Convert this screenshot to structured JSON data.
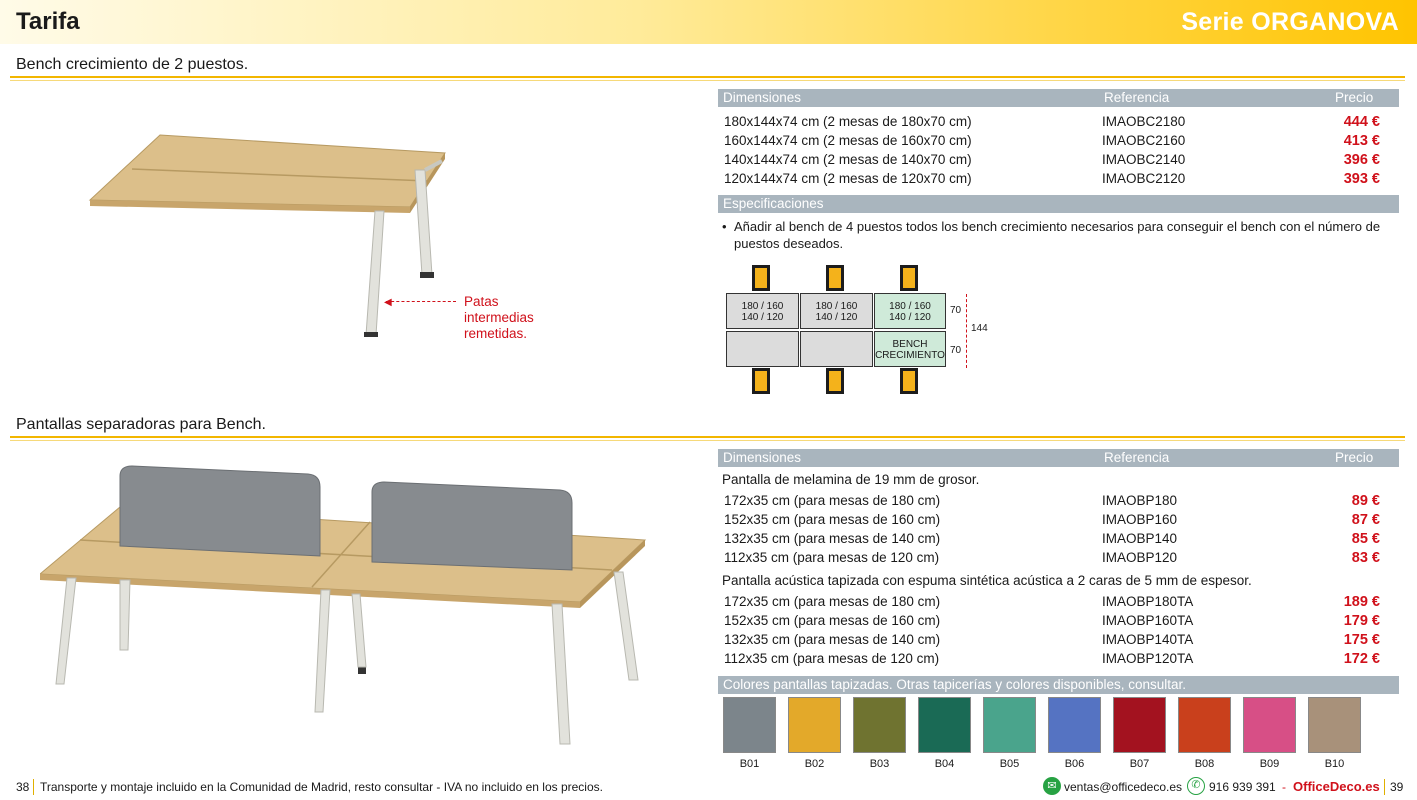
{
  "header": {
    "left_title": "Tarifa",
    "right_title": "Serie ORGANOVA"
  },
  "bench": {
    "title": "Bench crecimiento de 2 puestos.",
    "columns": [
      "Dimensiones",
      "Referencia",
      "Precio"
    ],
    "rows": [
      {
        "dim": "180x144x74 cm (2 mesas de 180x70 cm)",
        "ref": "IMAOBC2180",
        "price": "444 €"
      },
      {
        "dim": "160x144x74 cm (2 mesas de 160x70 cm)",
        "ref": "IMAOBC2160",
        "price": "413 €"
      },
      {
        "dim": "140x144x74 cm (2 mesas de 140x70 cm)",
        "ref": "IMAOBC2140",
        "price": "396 €"
      },
      {
        "dim": "120x144x74 cm (2 mesas de 120x70 cm)",
        "ref": "IMAOBC2120",
        "price": "393 €"
      }
    ],
    "specs_title": "Especificaciones",
    "spec_bullet": "Añadir al bench de 4 puestos todos los bench crecimiento necesarios para conseguir el bench con el número de puestos deseados.",
    "callout": [
      "Patas",
      "intermedias",
      "remetidas."
    ],
    "diagram": {
      "cell_line1": "180 / 160",
      "cell_line2": "140 / 120",
      "bench_line1": "BENCH",
      "bench_line2": "CRECIMIENTO",
      "dim_70": "70",
      "dim_144": "144"
    }
  },
  "screens": {
    "title": "Pantallas separadoras para Bench.",
    "columns": [
      "Dimensiones",
      "Referencia",
      "Precio"
    ],
    "group1_label": "Pantalla de melamina de 19 mm de grosor.",
    "group1": [
      {
        "dim": "172x35 cm (para mesas de 180 cm)",
        "ref": "IMAOBP180",
        "price": "89 €"
      },
      {
        "dim": "152x35 cm (para mesas de 160 cm)",
        "ref": "IMAOBP160",
        "price": "87 €"
      },
      {
        "dim": "132x35 cm (para mesas de 140 cm)",
        "ref": "IMAOBP140",
        "price": "85 €"
      },
      {
        "dim": "112x35 cm (para mesas de 120 cm)",
        "ref": "IMAOBP120",
        "price": "83 €"
      }
    ],
    "group2_label": "Pantalla acústica tapizada con espuma sintética acústica a 2 caras de 5 mm de espesor.",
    "group2": [
      {
        "dim": "172x35 cm (para mesas de 180 cm)",
        "ref": "IMAOBP180TA",
        "price": "189 €"
      },
      {
        "dim": "152x35 cm (para mesas de 160 cm)",
        "ref": "IMAOBP160TA",
        "price": "179 €"
      },
      {
        "dim": "132x35 cm (para mesas de 140 cm)",
        "ref": "IMAOBP140TA",
        "price": "175 €"
      },
      {
        "dim": "112x35 cm (para mesas de 120 cm)",
        "ref": "IMAOBP120TA",
        "price": "172 €"
      }
    ],
    "colors_title": "Colores pantallas tapizadas. Otras tapicerías y colores disponibles, consultar.",
    "swatches": [
      {
        "code": "B01",
        "color": "#7c858b"
      },
      {
        "code": "B02",
        "color": "#e3a92a"
      },
      {
        "code": "B03",
        "color": "#6f7330"
      },
      {
        "code": "B04",
        "color": "#1a6a55"
      },
      {
        "code": "B05",
        "color": "#4aa48c"
      },
      {
        "code": "B06",
        "color": "#5573c2"
      },
      {
        "code": "B07",
        "color": "#a3121f"
      },
      {
        "code": "B08",
        "color": "#c9401c"
      },
      {
        "code": "B09",
        "color": "#d74f86"
      },
      {
        "code": "B10",
        "color": "#a8917a"
      }
    ]
  },
  "footer": {
    "page_left": "38",
    "note": "Transporte y montaje incluido en la Comunidad de Madrid, resto consultar - IVA no incluido en los precios.",
    "email": "ventas@officedeco.es",
    "phone": "916 939 391",
    "separator": "-",
    "brand": "OfficeDeco.es",
    "page_right": "39"
  }
}
